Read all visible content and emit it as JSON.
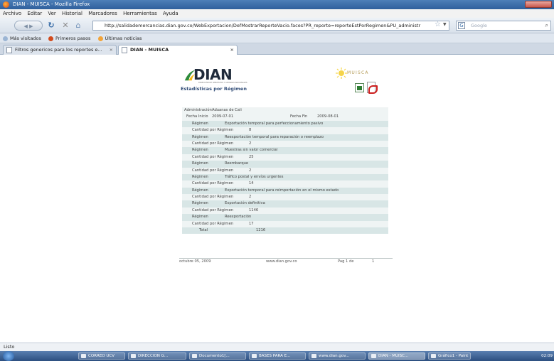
{
  "browser": {
    "window_title": "DIAN - MUISCA - Mozilla Firefox",
    "menu": [
      "Archivo",
      "Editar",
      "Ver",
      "Historial",
      "Marcadores",
      "Herramientas",
      "Ayuda"
    ],
    "url": "http://salidademercancias.dian.gov.co/WebExportacion/DefMostrarReporteVacio.faces?PR_reporte=reporteEstPorRegimen&PU_administr",
    "search_engine": "Google",
    "bookmarks": [
      "Más visitados",
      "Primeros pasos",
      "Últimas noticias"
    ],
    "tabs": [
      {
        "label": "Filtros genericos para los reportes e..."
      },
      {
        "label": "DIAN - MUISCA"
      }
    ],
    "status": "Listo"
  },
  "report": {
    "logo_text": "DIAN",
    "logo_tagline": "DIRECCIÓN DE IMPUESTOS Y ADUANAS NACIONALES",
    "muisca_text": "MUISCA",
    "title": "Estadísticas por Régimen",
    "administracion_label": "Administración",
    "administracion_value": "Aduanas de Cali",
    "fecha_inicio_label": "Fecha Inicio",
    "fecha_inicio_value": "2009-07-01",
    "fecha_fin_label": "Fecha Fin",
    "fecha_fin_value": "2009-08-01",
    "regimen_label": "Régimen",
    "cantidad_label": "Cantidad por Régimen",
    "regimenes": [
      {
        "nombre": "Exportación temporal para perfeccionamiento pasivo",
        "cantidad": "8"
      },
      {
        "nombre": "Reexportación temporal para reparación o reemplazo",
        "cantidad": "2"
      },
      {
        "nombre": "Muestras sin valor comercial",
        "cantidad": "25"
      },
      {
        "nombre": "Reembarque",
        "cantidad": "2"
      },
      {
        "nombre": "Tráfico postal y envíos urgentes",
        "cantidad": "14"
      },
      {
        "nombre": "Exportación temporal para reimportación en el mismo estado",
        "cantidad": "2"
      },
      {
        "nombre": "Exportación definitiva",
        "cantidad": "1146"
      },
      {
        "nombre": "Reexportación",
        "cantidad": "17"
      }
    ],
    "total_label": "Total",
    "total_value": "1216",
    "footer_date": "octubre 05, 2009",
    "footer_site": "www.dian.gov.co",
    "footer_page_label": "Pag 1 de",
    "footer_page_total": "1"
  },
  "taskbar": {
    "items": [
      "CORREO UCV",
      "DIRECCION G...",
      "Documento1[...",
      "BASES PARA E...",
      "www.dian.gov...",
      "DIAN - MUISC...",
      "Gráfico1 - Paint"
    ],
    "tray_time": "02:09"
  }
}
